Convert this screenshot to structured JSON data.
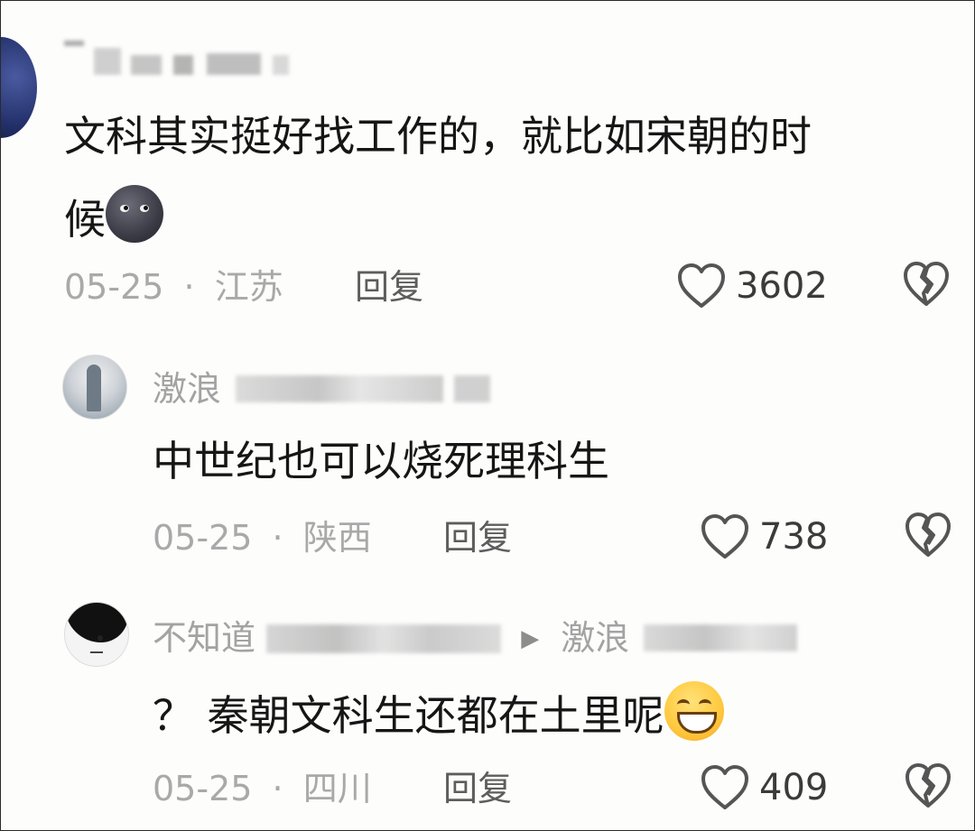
{
  "comments": [
    {
      "name": "",
      "content": "文科其实挺好找工作的，就比如宋朝的时候",
      "content_line1": "文科其实挺好找工作的，就比如宋朝的时",
      "content_line2": "候",
      "emoji": "new-moon-face-emoji",
      "date": "05-25",
      "separator": "·",
      "location": "江苏",
      "reply_label": "回复",
      "likes": "3602",
      "like_icon": "heart-outline-icon",
      "dislike_icon": "broken-heart-icon"
    },
    {
      "name_visible": "激浪",
      "content": "中世纪也可以烧死理科生",
      "date": "05-25",
      "separator": "·",
      "location": "陕西",
      "reply_label": "回复",
      "likes": "738",
      "like_icon": "heart-outline-icon",
      "dislike_icon": "broken-heart-icon"
    },
    {
      "name_visible": "不知道",
      "reply_arrow": "▶",
      "reply_to_visible": "激浪",
      "content": "？ 秦朝文科生还都在土里呢",
      "emoji": "grinning-face-emoji",
      "date": "05-25",
      "separator": "·",
      "location": "四川",
      "reply_label": "回复",
      "likes": "409",
      "like_icon": "heart-outline-icon",
      "dislike_icon": "broken-heart-icon"
    }
  ],
  "colors": {
    "meta_text": "#a9a9a9",
    "content_text": "#161616",
    "icon_stroke": "#555555"
  }
}
